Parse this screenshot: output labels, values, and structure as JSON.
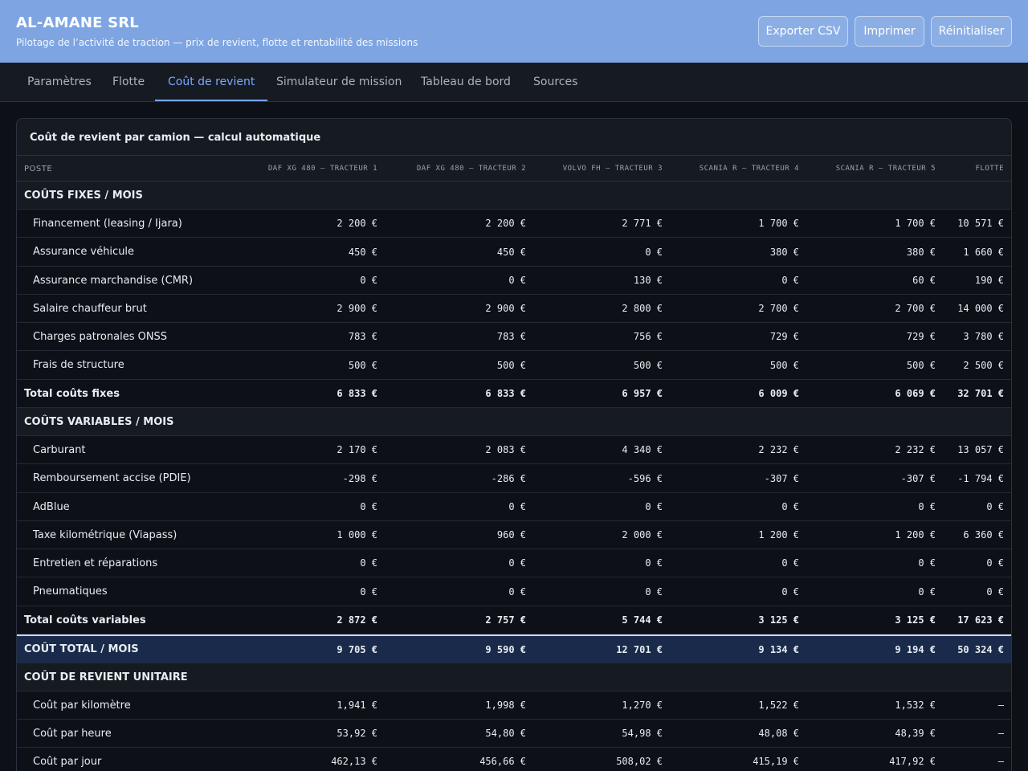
{
  "header": {
    "brand": "AL-AMANE SRL",
    "tagline": "Pilotage de l’activité de traction — prix de revient, flotte et rentabilité des missions",
    "buttons": {
      "export": "Exporter CSV",
      "print": "Imprimer",
      "reset": "Réinitialiser"
    }
  },
  "tabs": [
    {
      "label": "Paramètres",
      "active": false
    },
    {
      "label": "Flotte",
      "active": false
    },
    {
      "label": "Coût de revient",
      "active": true
    },
    {
      "label": "Simulateur de mission",
      "active": false
    },
    {
      "label": "Tableau de bord",
      "active": false
    },
    {
      "label": "Sources",
      "active": false
    }
  ],
  "card": {
    "title": "Coût de revient par camion — calcul automatique",
    "columns": [
      "Poste",
      "DAF XG 480 — Tracteur 1",
      "DAF XG 480 — Tracteur 2",
      "Volvo FH — Tracteur 3",
      "Scania R — Tracteur 4",
      "Scania R — Tracteur 5",
      "Flotte"
    ],
    "rows": [
      {
        "type": "section",
        "label": "COÛTS FIXES / MOIS",
        "values": []
      },
      {
        "type": "line",
        "label": "Financement (leasing / Ijara)",
        "values": [
          "2 200 €",
          "2 200 €",
          "2 771 €",
          "1 700 €",
          "1 700 €",
          "10 571 €"
        ]
      },
      {
        "type": "line",
        "label": "Assurance véhicule",
        "values": [
          "450 €",
          "450 €",
          "0 €",
          "380 €",
          "380 €",
          "1 660 €"
        ]
      },
      {
        "type": "line",
        "label": "Assurance marchandise (CMR)",
        "values": [
          "0 €",
          "0 €",
          "130 €",
          "0 €",
          "60 €",
          "190 €"
        ]
      },
      {
        "type": "line",
        "label": "Salaire chauffeur brut",
        "values": [
          "2 900 €",
          "2 900 €",
          "2 800 €",
          "2 700 €",
          "2 700 €",
          "14 000 €"
        ]
      },
      {
        "type": "line",
        "label": "Charges patronales ONSS",
        "values": [
          "783 €",
          "783 €",
          "756 €",
          "729 €",
          "729 €",
          "3 780 €"
        ]
      },
      {
        "type": "line",
        "label": "Frais de structure",
        "values": [
          "500 €",
          "500 €",
          "500 €",
          "500 €",
          "500 €",
          "2 500 €"
        ]
      },
      {
        "type": "total",
        "label": "Total coûts fixes",
        "values": [
          "6 833 €",
          "6 833 €",
          "6 957 €",
          "6 009 €",
          "6 069 €",
          "32 701 €"
        ]
      },
      {
        "type": "section",
        "label": "COÛTS VARIABLES / MOIS",
        "values": []
      },
      {
        "type": "line",
        "label": "Carburant",
        "values": [
          "2 170 €",
          "2 083 €",
          "4 340 €",
          "2 232 €",
          "2 232 €",
          "13 057 €"
        ]
      },
      {
        "type": "line",
        "label": "Remboursement accise (PDIE)",
        "values": [
          "-298 €",
          "-286 €",
          "-596 €",
          "-307 €",
          "-307 €",
          "-1 794 €"
        ]
      },
      {
        "type": "line",
        "label": "AdBlue",
        "values": [
          "0 €",
          "0 €",
          "0 €",
          "0 €",
          "0 €",
          "0 €"
        ]
      },
      {
        "type": "line",
        "label": "Taxe kilométrique (Viapass)",
        "values": [
          "1 000 €",
          "960 €",
          "2 000 €",
          "1 200 €",
          "1 200 €",
          "6 360 €"
        ]
      },
      {
        "type": "line",
        "label": "Entretien et réparations",
        "values": [
          "0 €",
          "0 €",
          "0 €",
          "0 €",
          "0 €",
          "0 €"
        ]
      },
      {
        "type": "line",
        "label": "Pneumatiques",
        "values": [
          "0 €",
          "0 €",
          "0 €",
          "0 €",
          "0 €",
          "0 €"
        ]
      },
      {
        "type": "total",
        "label": "Total coûts variables",
        "values": [
          "2 872 €",
          "2 757 €",
          "5 744 €",
          "3 125 €",
          "3 125 €",
          "17 623 €"
        ]
      },
      {
        "type": "grand",
        "label": "COÛT TOTAL / MOIS",
        "values": [
          "9 705 €",
          "9 590 €",
          "12 701 €",
          "9 134 €",
          "9 194 €",
          "50 324 €"
        ]
      },
      {
        "type": "section",
        "label": "COÛT DE REVIENT UNITAIRE",
        "values": []
      },
      {
        "type": "line",
        "label": "Coût par kilomètre",
        "values": [
          "1,941 €",
          "1,998 €",
          "1,270 €",
          "1,522 €",
          "1,532 €",
          "—"
        ]
      },
      {
        "type": "line",
        "label": "Coût par heure",
        "values": [
          "53,92 €",
          "54,80 €",
          "54,98 €",
          "48,08 €",
          "48,39 €",
          "—"
        ]
      },
      {
        "type": "line",
        "label": "Coût par jour",
        "values": [
          "462,13 €",
          "456,66 €",
          "508,02 €",
          "415,19 €",
          "417,92 €",
          "—"
        ]
      }
    ]
  }
}
